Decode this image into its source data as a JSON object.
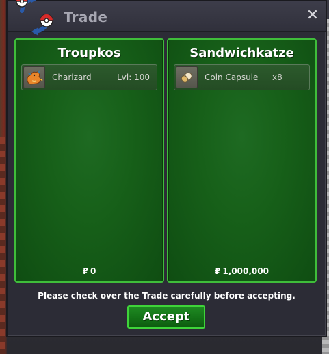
{
  "window": {
    "title": "Trade",
    "close_glyph": "✕"
  },
  "trade": {
    "left": {
      "name": "Troupkos",
      "item": {
        "icon": "charizard-icon",
        "name": "Charizard",
        "level": "Lvl: 100"
      },
      "money": "0"
    },
    "right": {
      "name": "Sandwichkatze",
      "item": {
        "icon": "coin-capsule-icon",
        "name": "Coin Capsule",
        "quantity": "x8"
      },
      "money": "1,000,000"
    },
    "money_symbol": "₽",
    "notice": "Please check over the Trade carefully before accepting.",
    "accept_label": "Accept"
  },
  "colors": {
    "panel_green": "#176019",
    "panel_border": "#3fbd3a",
    "window_bg": "#2c2c36",
    "title_text": "#a7a7b2"
  }
}
